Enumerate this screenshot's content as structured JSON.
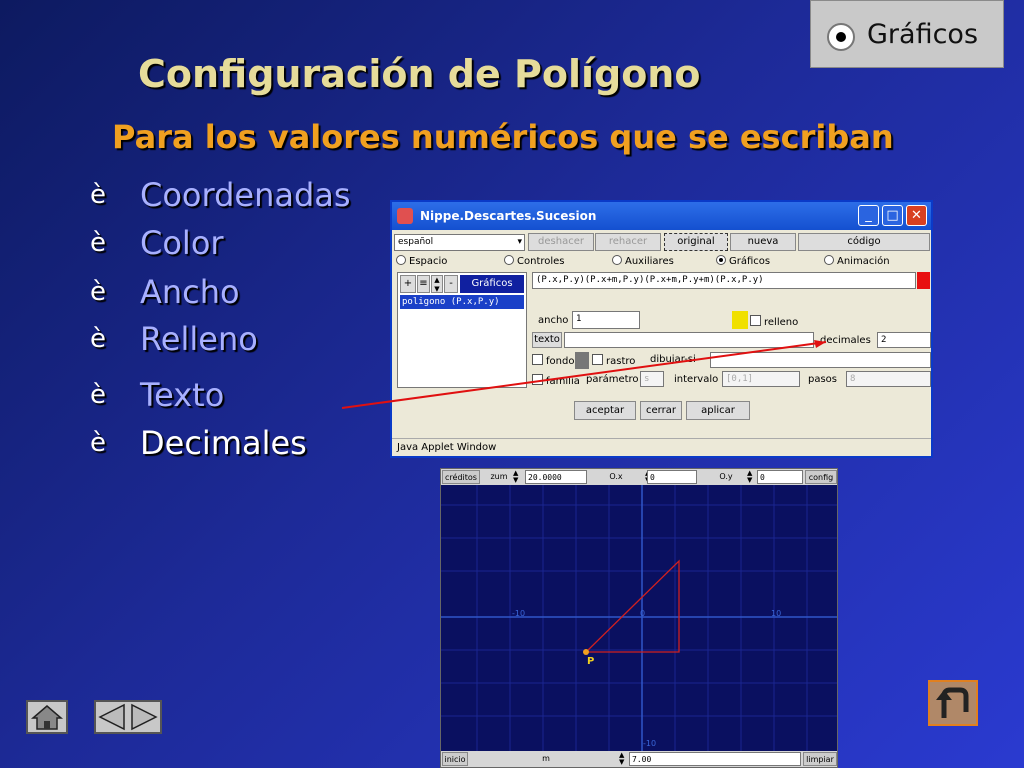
{
  "slide": {
    "badge_label": "Gráficos",
    "title": "Configuración de Polígono",
    "subtitle": "Para los valores numéricos que se escriban",
    "bullets": [
      {
        "label": "Coordenadas"
      },
      {
        "label": "Color"
      },
      {
        "label": "Ancho"
      },
      {
        "label": "Relleno"
      },
      {
        "label": "Texto"
      },
      {
        "label": "Decimales"
      }
    ],
    "bullet_arrow": "è"
  },
  "window": {
    "title": "Nippe.Descartes.Sucesion",
    "language": "español",
    "buttons": {
      "undo": "deshacer",
      "redo": "rehacer",
      "original": "original",
      "new": "nueva",
      "code": "código"
    },
    "radios": {
      "space": "Espacio",
      "controls": "Controles",
      "auxiliary": "Auxiliares",
      "graphics": "Gráficos",
      "animation": "Animación"
    },
    "list_header": "Gráficos",
    "list_item": "poligono (P.x,P.y)",
    "expression": "(P.x,P.y)(P.x+m,P.y)(P.x+m,P.y+m)(P.x,P.y)",
    "width_label": "ancho",
    "width_value": "1",
    "fill_label": "relleno",
    "text_label": "texto",
    "decimals_label": "decimales",
    "decimals_value": "2",
    "bg_label": "fondo",
    "trace_label": "rastro",
    "draw_if_label": "dibujar-si",
    "family_label": "familia",
    "parameter_label": "parámetro",
    "parameter_value": "s",
    "interval_label": "intervalo",
    "interval_value": "[0,1]",
    "steps_label": "pasos",
    "steps_value": "8",
    "accept": "aceptar",
    "close": "cerrar",
    "apply": "aplicar",
    "status": "Java Applet Window",
    "color_swatch": "#e81010",
    "fill_swatch": "#f0e000"
  },
  "graph": {
    "credits": "créditos",
    "zoom_label": "zum",
    "zoom_value": "20.0000",
    "ox_label": "O.x",
    "ox_value": "0",
    "oy_label": "O.y",
    "oy_value": "0",
    "config": "config",
    "start": "inicio",
    "m_label": "m",
    "m_value": "7.00",
    "clear": "limpiar",
    "tick_neg10": "-10",
    "tick_10": "10",
    "tick_0": "0",
    "point_label": "P"
  }
}
